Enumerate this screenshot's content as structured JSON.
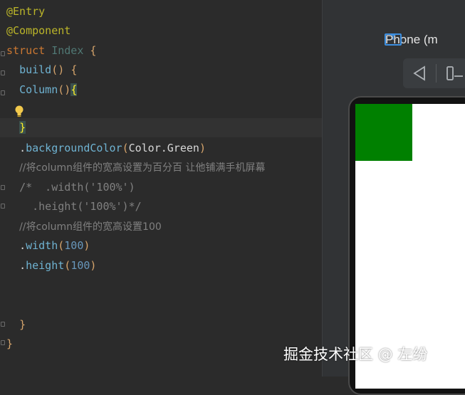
{
  "editor": {
    "lines": {
      "l1": {
        "anno": "@Entry"
      },
      "l2": {
        "anno": "@Component"
      },
      "l3": {
        "kw": "struct",
        "cls": "Index",
        "brace": "{"
      },
      "l4": {
        "fn": "build",
        "paren": "()",
        "brace": "{"
      },
      "l5": {
        "fn": "Column",
        "paren": "()",
        "brace": "{"
      },
      "l7": {
        "brace": "}"
      },
      "l8": {
        "pre": ".",
        "fn": "backgroundColor",
        "open": "(",
        "arg": "Color.Green",
        "close": ")"
      },
      "l9": {
        "comment": "//将column组件的宽高设置为百分百 让他铺满手机屏幕"
      },
      "l10": {
        "comment": "/*  .width('100%')"
      },
      "l11": {
        "comment": "  .height('100%')*/"
      },
      "l12": {
        "comment": "//将column组件的宽高设置100"
      },
      "l13": {
        "pre": ".",
        "fn": "width",
        "open": "(",
        "num": "100",
        "close": ")"
      },
      "l14": {
        "pre": ".",
        "fn": "height",
        "open": "(",
        "num": "100",
        "close": ")"
      },
      "l17": {
        "brace": "}"
      },
      "l18": {
        "brace": "}"
      }
    }
  },
  "preview": {
    "device_label": "Phone (m",
    "device_icon": "T",
    "toolbar": {
      "back_icon": "back-triangle-icon",
      "rotate_icon": "rotate-device-icon"
    }
  },
  "watermark": "掘金技术社区 @ 左纷",
  "colors": {
    "green_box": "#008000",
    "screen": "#ffffff"
  }
}
